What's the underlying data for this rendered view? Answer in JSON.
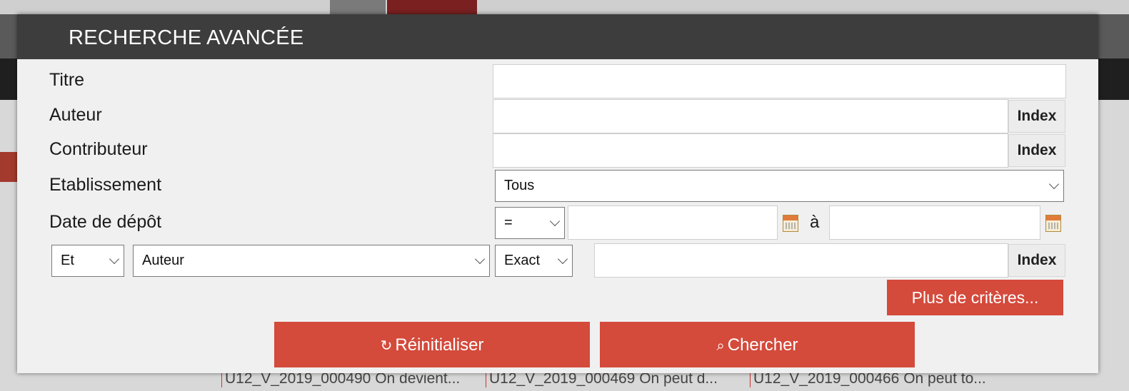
{
  "background": {
    "rows": [
      "U12_V_2019_000490 On devient...",
      "U12_V_2019_000469 On peut d...",
      "U12_V_2019_000466 On peut to..."
    ]
  },
  "modal": {
    "title": "RECHERCHE AVANCÉE",
    "fields": {
      "titre": {
        "label": "Titre",
        "value": "",
        "placeholder": ""
      },
      "auteur": {
        "label": "Auteur",
        "value": "",
        "placeholder": ""
      },
      "contributeur": {
        "label": "Contributeur",
        "value": "",
        "placeholder": ""
      },
      "etablissement": {
        "label": "Etablissement",
        "selected": "Tous"
      },
      "date_depot": {
        "label": "Date de dépôt",
        "operator": "=",
        "from": "",
        "separator": "à",
        "to": ""
      }
    },
    "criteria_row": {
      "logic": "Et",
      "field": "Auteur",
      "match": "Exact",
      "value": ""
    },
    "index_label": "Index",
    "more_criteria_label": "Plus de critères...",
    "reset_label": "Réinitialiser",
    "search_label": "Chercher",
    "colors": {
      "accent": "#d44a3b",
      "header": "#3d3d3d"
    }
  }
}
